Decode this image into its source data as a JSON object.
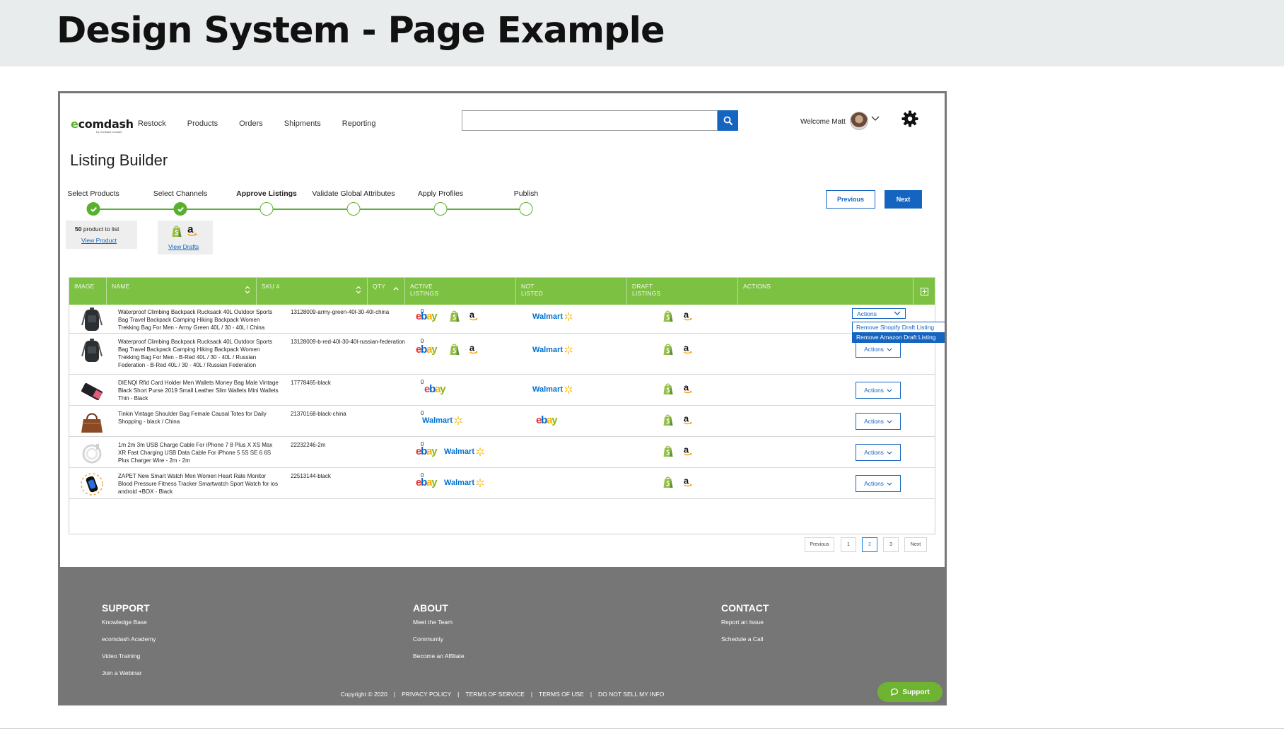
{
  "slide": {
    "title": "Design System - Page Example"
  },
  "nav": {
    "logo_text": "ecomdash",
    "logo_tagline": "by Constant Contact",
    "items": [
      "Restock",
      "Products",
      "Orders",
      "Shipments",
      "Reporting"
    ],
    "search_placeholder": "",
    "welcome": "Welcome Matt"
  },
  "page": {
    "title": "Listing Builder"
  },
  "stepper": {
    "steps": [
      {
        "label": "Select Products",
        "done": true
      },
      {
        "label": "Select Channels",
        "done": true
      },
      {
        "label": "Approve Listings",
        "done": false,
        "active": true
      },
      {
        "label": "Validate Global Attributes",
        "done": false
      },
      {
        "label": "Apply Profiles",
        "done": false
      },
      {
        "label": "Publish",
        "done": false
      }
    ],
    "previous_label": "Previous",
    "next_label": "Next"
  },
  "summary": {
    "count_num": "50",
    "count_text": " product to list",
    "view_product": "View Product",
    "view_drafts": "View Drafts"
  },
  "table": {
    "headers": {
      "image": "IMAGE",
      "name": "NAME",
      "sku": "SKU #",
      "qty": "QTY",
      "active": "ACTIVE\nLISTINGS",
      "not_listed": "NOT\nLISTED",
      "draft": "DRAFT\nLISTINGS",
      "actions": "ACTIONS"
    },
    "actions_label": "Actions",
    "dropdown_options": [
      "Remove Shopify Draft Listing",
      "Remove Amazon Draft Listing"
    ],
    "rows": [
      {
        "name": "Waterproof Climbing Backpack Rucksack 40L Outdoor Sports Bag Travel Backpack Camping Hiking Backpack Women Trekking Bag For Men - Army Green 40L / 30 - 40L / China",
        "sku": "13128009-army-green-40l-30-40l-china",
        "qty": "0",
        "active": [
          "ebay",
          "shopify",
          "amazon"
        ],
        "not_listed": [
          "walmart"
        ]
      },
      {
        "name": "Waterproof Climbing Backpack Rucksack 40L Outdoor Sports Bag Travel Backpack Camping Hiking Backpack Women Trekking Bag For Men - B-Red 40L / 30 - 40L / Russian Federation - B-Red 40L / 30 - 40L / Russian Federation",
        "sku": "13128009-b-red-40l-30-40l-russian-federation",
        "qty": "0",
        "active": [
          "ebay",
          "shopify",
          "amazon"
        ],
        "not_listed": [
          "walmart"
        ]
      },
      {
        "name": "DIENQI Rfid Card Holder Men Wallets Money Bag Male Vintage Black Short Purse 2019 Small Leather Slim Wallets Mini Wallets Thin - Black",
        "sku": "17778465-black",
        "qty": "0",
        "active": [
          "ebay"
        ],
        "not_listed": [
          "walmart"
        ]
      },
      {
        "name": "Tinkin Vintage Shoulder Bag Female Causal Totes for Daily Shopping - black / China",
        "sku": "21370168-black-china",
        "qty": "0",
        "active": [
          "walmart"
        ],
        "not_listed": [
          "ebay"
        ]
      },
      {
        "name": "1m 2m 3m USB Charge Cable For iPhone 7 8 Plus X XS Max XR Fast Charging USB Data Cable For iPhone 5 5S SE 6 6S Plus Charger Wire - 2m - 2m",
        "sku": "22232246-2m",
        "qty": "0",
        "active": [
          "ebay",
          "walmart"
        ],
        "not_listed": []
      },
      {
        "name": "ZAPET New Smart Watch Men Women Heart Rate Monitor Blood Pressure Fitness Tracker Smartwatch Sport Watch for ios android +BOX - Black",
        "sku": "22513144-black",
        "qty": "0",
        "active": [
          "ebay",
          "walmart"
        ],
        "not_listed": []
      }
    ]
  },
  "pagination": {
    "previous": "Previous",
    "pages": [
      "1",
      "2",
      "3"
    ],
    "current": "2",
    "next": "Next"
  },
  "footer": {
    "support": {
      "title": "SUPPORT",
      "links": [
        "Knowledge Base",
        "ecomdash Academy",
        "Video Training",
        "Join a Webinar"
      ]
    },
    "about": {
      "title": "ABOUT",
      "links": [
        "Meet the Team",
        "Community",
        "Become an Affiliate"
      ]
    },
    "contact": {
      "title": "CONTACT",
      "links": [
        "Report an Issue",
        "Schedule a Call"
      ]
    },
    "bottom": [
      "Copyright © 2020",
      "PRIVACY POLICY",
      "TERMS OF SERVICE",
      "TERMS OF USE",
      "DO NOT SELL MY INFO"
    ],
    "support_button": "Support"
  },
  "brand_colors": {
    "green": "#7dc142",
    "blue": "#1565c0",
    "footer_gray": "#767676"
  },
  "icons": [
    "search-icon",
    "chevron-down-icon",
    "gear-icon",
    "check-icon",
    "sort-icon",
    "add-column-icon",
    "shopify-icon",
    "amazon-icon",
    "ebay-logo",
    "walmart-logo",
    "chat-icon"
  ]
}
